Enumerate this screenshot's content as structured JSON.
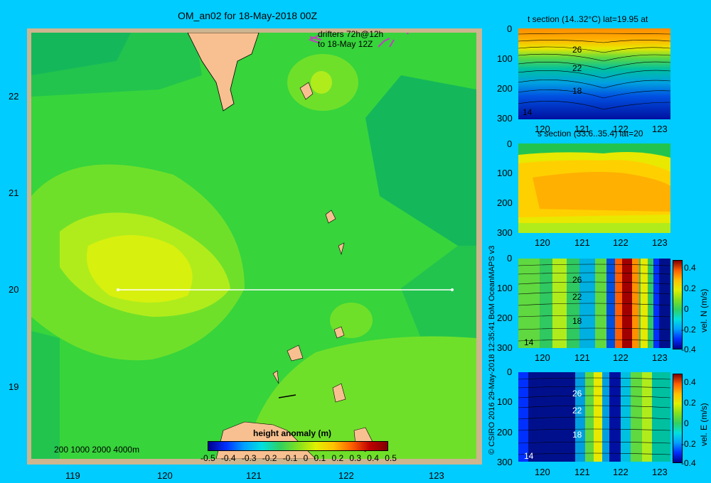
{
  "map": {
    "title": "OM_an02 for 18-May-2018 00Z",
    "drifters_line1": "drifters 72h@12h",
    "drifters_line2": "to 18-May 12Z",
    "lon_ticks": [
      "119",
      "120",
      "121",
      "122",
      "123"
    ],
    "lat_ticks": [
      "22",
      "21",
      "20",
      "19"
    ],
    "depth_legend": "200  1000  2000  4000m",
    "colorbar_title": "height anomaly (m)",
    "colorbar_ticks": [
      "-0.5",
      "-0.4",
      "-0.3",
      "-0.2",
      "-0.1",
      "0",
      "0.1",
      "0.2",
      "0.3",
      "0.4",
      "0.5"
    ],
    "section_line": {
      "lat": 20,
      "lon_start": 119.5,
      "lon_end": 123.2
    }
  },
  "credit": "© CSIRO 2016   29-May-2018 12:35:41 BoM OceanMAPS v3",
  "panels": [
    {
      "title": "t section (14..32°C) lat=19.95 at",
      "contour_labels": [
        "26",
        "22",
        "18",
        "14"
      ],
      "colorbar": null
    },
    {
      "title": "s section (33.6..35.4) lat=20",
      "contour_labels": [],
      "colorbar": null
    },
    {
      "title": "",
      "contour_labels": [
        "26",
        "22",
        "18",
        "14"
      ],
      "colorbar": {
        "label": "vel. N (m/s)",
        "ticks": [
          "0.4",
          "0.2",
          "0",
          "-0.2",
          "-0.4"
        ]
      }
    },
    {
      "title": "",
      "contour_labels": [
        "26",
        "22",
        "18",
        "14"
      ],
      "colorbar": {
        "label": "vel. E (m/s)",
        "ticks": [
          "0.4",
          "0.2",
          "0",
          "-0.2",
          "-0.4"
        ]
      }
    }
  ],
  "panel_x_ticks": [
    "120",
    "121",
    "122",
    "123"
  ],
  "panel_y_ticks": [
    "0",
    "100",
    "200",
    "300"
  ]
}
